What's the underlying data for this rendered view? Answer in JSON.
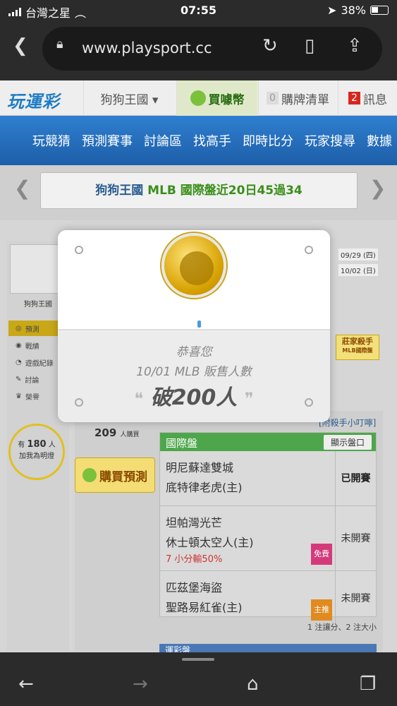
{
  "status": {
    "carrier": "台灣之星",
    "time": "07:55",
    "battery": "38%"
  },
  "browser": {
    "url": "www.playsport.cc"
  },
  "site": {
    "logo": "玩運彩",
    "user_menu": "狗狗王國 ▾",
    "buy_coins": "買噱幣",
    "cart_count": "0",
    "cart_label": "購牌清單",
    "msg_count": "2",
    "msg_label": "訊息"
  },
  "nav": [
    "玩競猜",
    "預測賽事",
    "討論區",
    "找高手",
    "即時比分",
    "玩家搜尋",
    "數據"
  ],
  "banner": {
    "name": "狗狗王國",
    "text": "MLB 國際盤近20日45過34"
  },
  "sidebar": {
    "username": "狗狗王國",
    "items": [
      "預測",
      "戰績",
      "遊戲紀錄",
      "討論",
      "榮譽"
    ],
    "light_prefix": "有",
    "light_count": "180",
    "light_suffix": "人",
    "light_sub": "加我為明燈"
  },
  "dates": [
    "09/29 (四)",
    "10/02 (日)"
  ],
  "right_badge": "莊家殺手",
  "right_badge_sub": "MLB國際盤",
  "buyers": {
    "count": "209",
    "label": "人購買"
  },
  "buy_button": "購買預測",
  "notice": "[附殺手小叮嚀]",
  "games": {
    "title": "國際盤",
    "show_button": "顯示盤口",
    "rows": [
      {
        "away": "明尼蘇達雙城",
        "home": "底特律老虎(主)",
        "status": "已開賽",
        "note": "",
        "tag": ""
      },
      {
        "away": "坦帕灣光芒",
        "home": "休士頓太空人(主)",
        "status": "未開賽",
        "note": "7 小分輸50%",
        "tag": "免費"
      },
      {
        "away": "匹茲堡海盜",
        "home": "聖路易紅雀(主)",
        "status": "未開賽",
        "note": "",
        "tag": "主推"
      }
    ],
    "footer": "1 注讓分、2 注大小"
  },
  "next_title": "運彩盤",
  "modal": {
    "line1": "恭喜您",
    "line2": "10/01 MLB 販售人數",
    "line3": "破200人"
  },
  "colors": {
    "nav_blue": "#1d5ea8",
    "green": "#4ea64a",
    "gold": "#d7a100"
  }
}
